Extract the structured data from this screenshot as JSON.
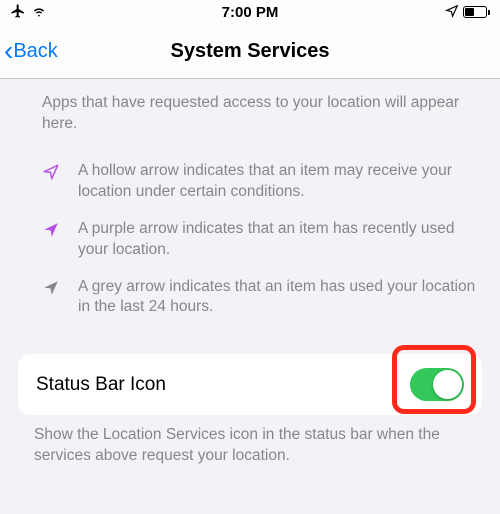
{
  "status": {
    "time": "7:00 PM"
  },
  "nav": {
    "back": "Back",
    "title": "System Services"
  },
  "intro": "Apps that have requested access to your location will appear here.",
  "legend": {
    "hollow": "A hollow arrow indicates that an item may receive your location under certain conditions.",
    "purple": "A purple arrow indicates that an item has recently used your location.",
    "grey": "A grey arrow indicates that an item has used your location in the last 24 hours."
  },
  "row": {
    "label": "Status Bar Icon"
  },
  "footer": "Show the Location Services icon in the status bar when the services above request your location.",
  "colors": {
    "purple": "#b550e6",
    "grey": "#86868b",
    "green": "#34c759"
  }
}
